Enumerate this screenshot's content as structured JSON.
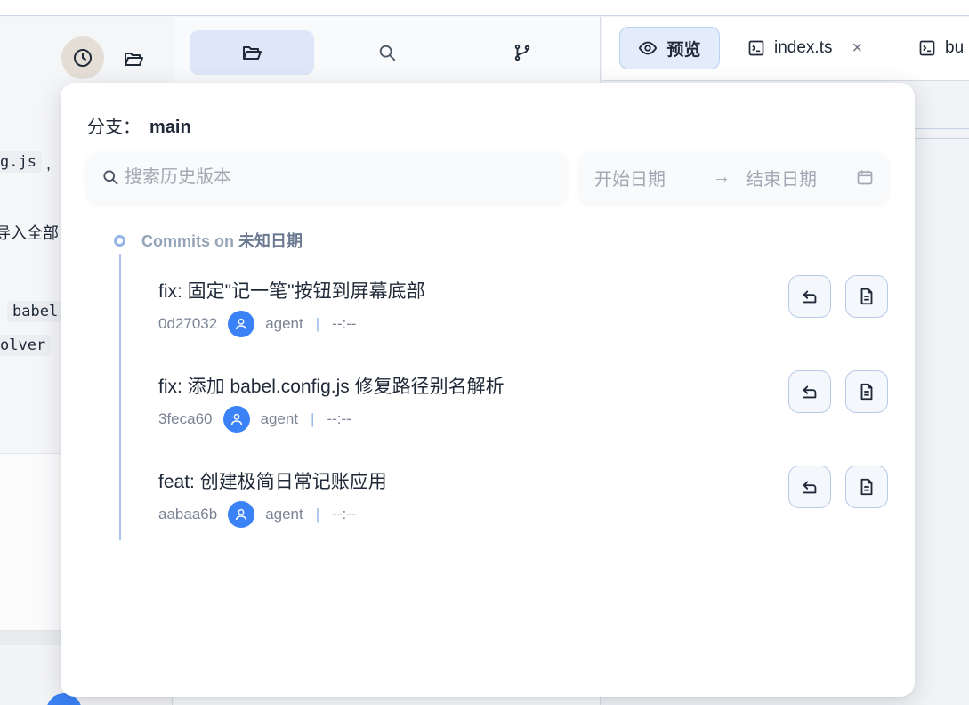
{
  "left_pane": {
    "fragments": {
      "code1": "g.js",
      "comma": ",",
      "text1": "导入全部",
      "code2": "babel",
      "code3": "olver"
    }
  },
  "editor_tabs": {
    "preview_label": "预览",
    "file1": "index.ts",
    "file1_close": "×",
    "file2": "bu"
  },
  "history": {
    "branch_label": "分支：",
    "branch_name": "main",
    "search": {
      "placeholder": "搜索历史版本",
      "value": ""
    },
    "date_range": {
      "start_placeholder": "开始日期",
      "arrow": "→",
      "end_placeholder": "结束日期"
    },
    "group": {
      "prefix": "Commits on",
      "date": "未知日期"
    },
    "commits": [
      {
        "message": "fix: 固定\"记一笔\"按钮到屏幕底部",
        "hash": "0d27032",
        "author": "agent",
        "separator": "|",
        "time": "--:--"
      },
      {
        "message": "fix: 添加 babel.config.js 修复路径别名解析",
        "hash": "3feca60",
        "author": "agent",
        "separator": "|",
        "time": "--:--"
      },
      {
        "message": "feat: 创建极简日常记账应用",
        "hash": "aabaa6b",
        "author": "agent",
        "separator": "|",
        "time": "--:--"
      }
    ]
  },
  "colors": {
    "accent": "#3b82f6",
    "active_tab_bg": "#e3ecfb",
    "timeline": "#a9c3ea"
  }
}
